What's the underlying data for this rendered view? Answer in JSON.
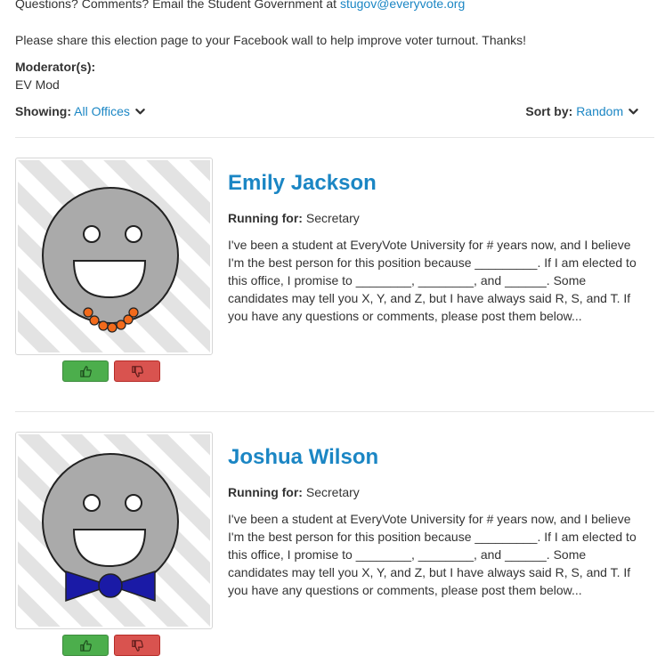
{
  "header": {
    "contact_text": "Questions? Comments? Email the Student Government at ",
    "contact_email": "stugov@everyvote.org",
    "share_text": "Please share this election page to your Facebook wall to help improve voter turnout. Thanks!"
  },
  "moderators": {
    "label": "Moderator(s):",
    "name": "EV Mod"
  },
  "filters": {
    "showing_label": "Showing:",
    "showing_value": "All Offices",
    "sort_label": "Sort by:",
    "sort_value": "Random"
  },
  "candidates": [
    {
      "name": "Emily Jackson",
      "running_label": "Running for:",
      "office": "Secretary",
      "bio": "I've been a student at EveryVote University for # years now, and I believe I'm the best person for this position because _________. If I am elected to this office, I promise to ________, ________, and ______. Some candidates may tell you X, Y, and Z, but I have always said R, S, and T. If you have any questions or comments, please post them below...",
      "accessory": "necklace",
      "accessory_color": "#f26a1b"
    },
    {
      "name": "Joshua Wilson",
      "running_label": "Running for:",
      "office": "Secretary",
      "bio": "I've been a student at EveryVote University for # years now, and I believe I'm the best person for this position because _________. If I am elected to this office, I promise to ________, ________, and ______. Some candidates may tell you X, Y, and Z, but I have always said R, S, and T. If you have any questions or comments, please post them below...",
      "accessory": "bow-tie",
      "accessory_color": "#1a1aa6"
    }
  ],
  "colors": {
    "link": "#1b86c4",
    "upvote": "#4cae4c",
    "downvote": "#d9534f",
    "face": "#aaaaaa",
    "stripes": "#e3e3e3"
  }
}
